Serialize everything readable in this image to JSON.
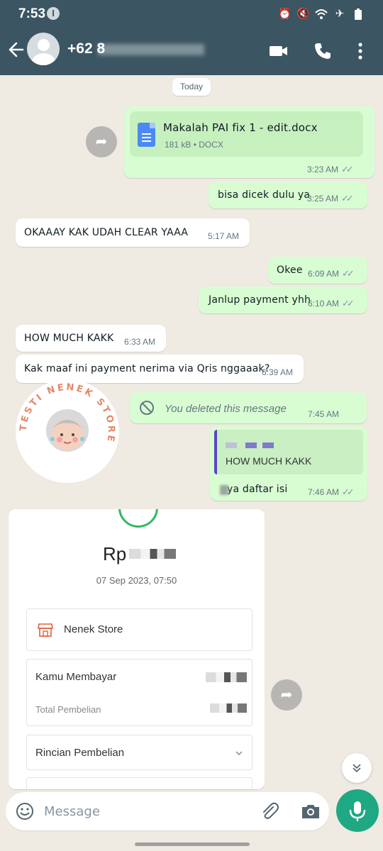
{
  "status_bar": {
    "time": "7:53",
    "badge": "I"
  },
  "header": {
    "contact_prefix": "+62 8"
  },
  "chat": {
    "day_label": "Today",
    "document": {
      "name": "Makalah PAI fix 1 - edit.docx",
      "info": "181 kB • DOCX",
      "time": "3:23 AM"
    },
    "messages": [
      {
        "text": "bisa dicek dulu ya",
        "time": "3:25 AM"
      },
      {
        "text": "OKAAAY KAK UDAH CLEAR YAAA",
        "time": "5:17 AM"
      },
      {
        "text": "Okee",
        "time": "6:09 AM"
      },
      {
        "text": "Janlup payment yhh",
        "time": "6:10 AM"
      },
      {
        "text": "HOW MUCH KAKK",
        "time": "6:33 AM"
      },
      {
        "text": "Kak maaf ini payment nerima via Qris nggaaak?",
        "time": "6:39 AM"
      },
      {
        "text": "You deleted this message",
        "time": "7:45 AM"
      },
      {
        "quoted_text": "HOW MUCH KAKK",
        "text": "ya daftar isi",
        "time": "7:46 AM"
      }
    ],
    "sticker": {
      "text": "TESTI NENEK STORE"
    }
  },
  "receipt": {
    "amount_prefix": "Rp",
    "date": "07 Sep 2023, 07:50",
    "store_name": "Nenek Store",
    "paid_label": "Kamu Membayar",
    "total_label": "Total Pembelian",
    "details_label": "Rincian Pembelian"
  },
  "composer": {
    "placeholder": "Message"
  },
  "colors": {
    "header": "#3b5563",
    "outgoing": "#d9fdd3",
    "incoming": "#ffffff",
    "mic": "#1fa884",
    "accent_quote": "#5a46c9"
  }
}
